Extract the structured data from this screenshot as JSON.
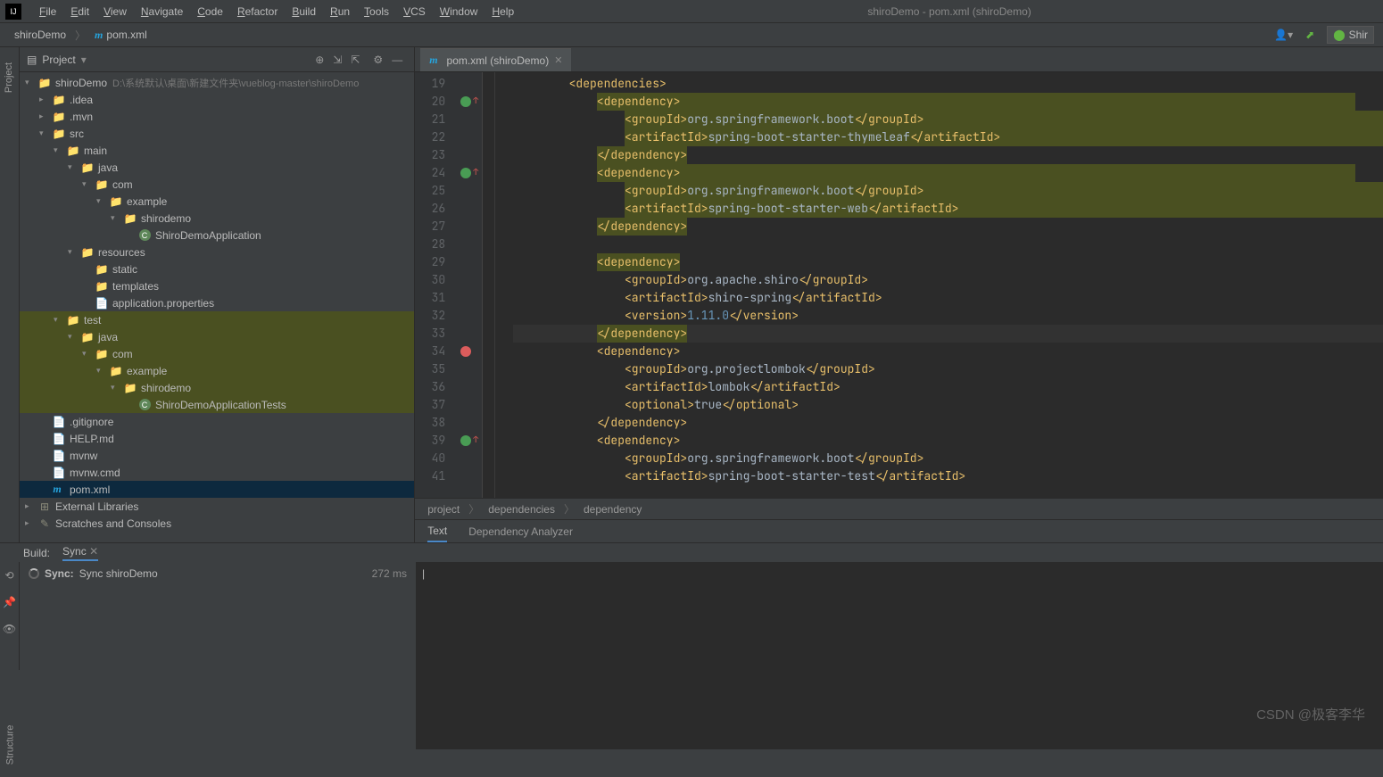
{
  "menu": [
    "File",
    "Edit",
    "View",
    "Navigate",
    "Code",
    "Refactor",
    "Build",
    "Run",
    "Tools",
    "VCS",
    "Window",
    "Help"
  ],
  "window_title": "shiroDemo - pom.xml (shiroDemo)",
  "breadcrumb": {
    "root": "shiroDemo",
    "file": "pom.xml"
  },
  "panel": {
    "title": "Project",
    "tree": [
      {
        "d": 0,
        "ch": "▾",
        "ic": "folder-blue",
        "txt": "shiroDemo",
        "path": "D:\\系统默认\\桌面\\新建文件夹\\vueblog-master\\shiroDemo",
        "hl": false
      },
      {
        "d": 1,
        "ch": "▸",
        "ic": "folder",
        "txt": ".idea"
      },
      {
        "d": 1,
        "ch": "▸",
        "ic": "folder",
        "txt": ".mvn"
      },
      {
        "d": 1,
        "ch": "▾",
        "ic": "folder-blue",
        "txt": "src"
      },
      {
        "d": 2,
        "ch": "▾",
        "ic": "folder-blue",
        "txt": "main"
      },
      {
        "d": 3,
        "ch": "▾",
        "ic": "folder-blue",
        "txt": "java"
      },
      {
        "d": 4,
        "ch": "▾",
        "ic": "folder",
        "txt": "com"
      },
      {
        "d": 5,
        "ch": "▾",
        "ic": "folder",
        "txt": "example"
      },
      {
        "d": 6,
        "ch": "▾",
        "ic": "folder",
        "txt": "shirodemo"
      },
      {
        "d": 7,
        "ch": "",
        "ic": "class",
        "txt": "ShiroDemoApplication"
      },
      {
        "d": 3,
        "ch": "▾",
        "ic": "folder",
        "txt": "resources"
      },
      {
        "d": 4,
        "ch": "",
        "ic": "folder",
        "txt": "static"
      },
      {
        "d": 4,
        "ch": "",
        "ic": "folder",
        "txt": "templates"
      },
      {
        "d": 4,
        "ch": "",
        "ic": "file",
        "txt": "application.properties"
      },
      {
        "d": 2,
        "ch": "▾",
        "ic": "folder",
        "txt": "test",
        "hl": true
      },
      {
        "d": 3,
        "ch": "▾",
        "ic": "folder-green",
        "txt": "java",
        "hl": true
      },
      {
        "d": 4,
        "ch": "▾",
        "ic": "folder",
        "txt": "com",
        "hl": true
      },
      {
        "d": 5,
        "ch": "▾",
        "ic": "folder",
        "txt": "example",
        "hl": true
      },
      {
        "d": 6,
        "ch": "▾",
        "ic": "folder",
        "txt": "shirodemo",
        "hl": true
      },
      {
        "d": 7,
        "ch": "",
        "ic": "class",
        "txt": "ShiroDemoApplicationTests",
        "hl": true
      },
      {
        "d": 1,
        "ch": "",
        "ic": "file",
        "txt": ".gitignore"
      },
      {
        "d": 1,
        "ch": "",
        "ic": "file",
        "txt": "HELP.md"
      },
      {
        "d": 1,
        "ch": "",
        "ic": "file",
        "txt": "mvnw"
      },
      {
        "d": 1,
        "ch": "",
        "ic": "file",
        "txt": "mvnw.cmd"
      },
      {
        "d": 1,
        "ch": "",
        "ic": "m",
        "txt": "pom.xml",
        "sel": true
      },
      {
        "d": 0,
        "ch": "▸",
        "ic": "lib",
        "txt": "External Libraries"
      },
      {
        "d": 0,
        "ch": "▸",
        "ic": "scratch",
        "txt": "Scratches and Consoles"
      }
    ]
  },
  "editor_tab": "pom.xml (shiroDemo)",
  "line_start": 19,
  "code_lines": [
    {
      "seg": [
        [
          "tag",
          "<dependencies>"
        ]
      ],
      "ind": 2
    },
    {
      "seg": [
        [
          "tag",
          "<dependency>"
        ]
      ],
      "ind": 3,
      "hl": true
    },
    {
      "seg": [
        [
          "tag",
          "<groupId>"
        ],
        [
          "txt",
          "org.springframework.boot"
        ],
        [
          "tag",
          "</groupId>"
        ]
      ],
      "ind": 4,
      "hl": true
    },
    {
      "seg": [
        [
          "tag",
          "<artifactId>"
        ],
        [
          "txt",
          "spring-boot-starter-thymeleaf"
        ],
        [
          "tag",
          "</artifactId>"
        ]
      ],
      "ind": 4,
      "hl": true
    },
    {
      "seg": [
        [
          "tag",
          "</dependency>"
        ]
      ],
      "ind": 3,
      "hl": true,
      "short": true
    },
    {
      "seg": [
        [
          "tag",
          "<dependency>"
        ]
      ],
      "ind": 3,
      "hl": true
    },
    {
      "seg": [
        [
          "tag",
          "<groupId>"
        ],
        [
          "txt",
          "org.springframework.boot"
        ],
        [
          "tag",
          "</groupId>"
        ]
      ],
      "ind": 4,
      "hl": true
    },
    {
      "seg": [
        [
          "tag",
          "<artifactId>"
        ],
        [
          "txt",
          "spring-boot-starter-web"
        ],
        [
          "tag",
          "</artifactId>"
        ]
      ],
      "ind": 4,
      "hl": true
    },
    {
      "seg": [
        [
          "tag",
          "</dependency>"
        ]
      ],
      "ind": 3,
      "hl": true,
      "short": true
    },
    {
      "seg": [],
      "ind": 0
    },
    {
      "seg": [
        [
          "tag",
          "<dependency>"
        ]
      ],
      "ind": 3,
      "short": true,
      "hl2": true
    },
    {
      "seg": [
        [
          "tag",
          "<groupId>"
        ],
        [
          "txt",
          "org.apache.shiro"
        ],
        [
          "tag",
          "</groupId>"
        ]
      ],
      "ind": 4
    },
    {
      "seg": [
        [
          "tag",
          "<artifactId>"
        ],
        [
          "txt",
          "shiro-spring"
        ],
        [
          "tag",
          "</artifactId>"
        ]
      ],
      "ind": 4
    },
    {
      "seg": [
        [
          "tag",
          "<version>"
        ],
        [
          "ver",
          "1.11.0"
        ],
        [
          "tag",
          "</version>"
        ]
      ],
      "ind": 4
    },
    {
      "seg": [
        [
          "tag",
          "</dependency>"
        ]
      ],
      "ind": 3,
      "cur": true,
      "short": true,
      "hl2": true
    },
    {
      "seg": [
        [
          "tag",
          "<dependency>"
        ]
      ],
      "ind": 3
    },
    {
      "seg": [
        [
          "tag",
          "<groupId>"
        ],
        [
          "txt",
          "org.projectlombok"
        ],
        [
          "tag",
          "</groupId>"
        ]
      ],
      "ind": 4
    },
    {
      "seg": [
        [
          "tag",
          "<artifactId>"
        ],
        [
          "txt",
          "lombok"
        ],
        [
          "tag",
          "</artifactId>"
        ]
      ],
      "ind": 4
    },
    {
      "seg": [
        [
          "tag",
          "<optional>"
        ],
        [
          "txt",
          "true"
        ],
        [
          "tag",
          "</optional>"
        ]
      ],
      "ind": 4
    },
    {
      "seg": [
        [
          "tag",
          "</dependency>"
        ]
      ],
      "ind": 3
    },
    {
      "seg": [
        [
          "tag",
          "<dependency>"
        ]
      ],
      "ind": 3
    },
    {
      "seg": [
        [
          "tag",
          "<groupId>"
        ],
        [
          "txt",
          "org.springframework.boot"
        ],
        [
          "tag",
          "</groupId>"
        ]
      ],
      "ind": 4
    },
    {
      "seg": [
        [
          "tag",
          "<artifactId>"
        ],
        [
          "txt",
          "spring-boot-starter-test"
        ],
        [
          "tag",
          "</artifactId>"
        ]
      ],
      "ind": 4
    }
  ],
  "crumbs": [
    "project",
    "dependencies",
    "dependency"
  ],
  "bottom_tabs": [
    "Text",
    "Dependency Analyzer"
  ],
  "build": {
    "label": "Build:",
    "tab": "Sync",
    "task_bold": "Sync:",
    "task": "Sync shiroDemo",
    "time": "272 ms"
  },
  "watermark": "CSDN @极客李华",
  "rail_left": "Project",
  "rail_bottom": "Structure",
  "shiro_btn": "Shir"
}
